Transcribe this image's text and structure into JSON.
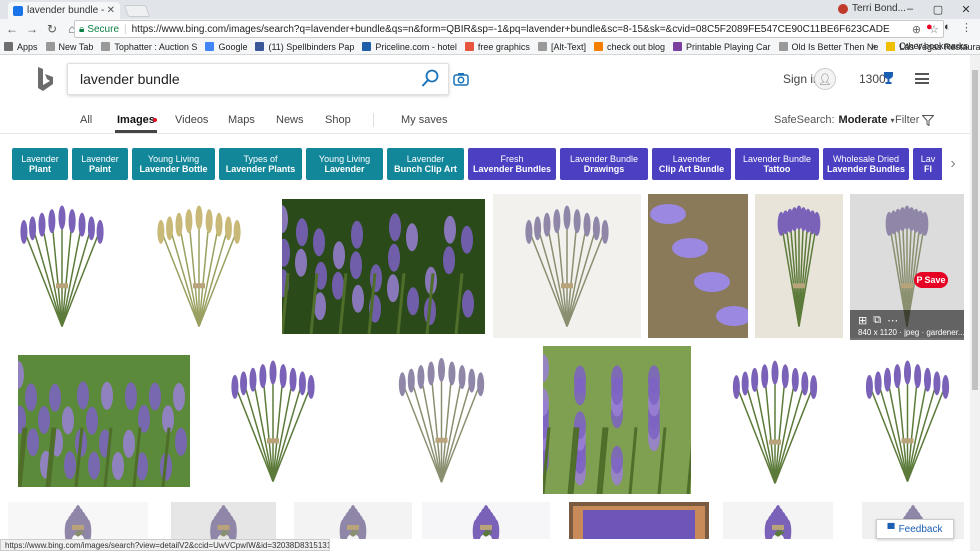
{
  "browser": {
    "tab_title": "lavender bundle - Bing i",
    "profile_name": "Terri Bond...",
    "secure_label": "Secure",
    "url": "https://www.bing.com/images/search?q=lavender+bundle&qs=n&form=QBIR&sp=-1&pq=lavender+bundle&sc=8-15&sk=&cvid=08C5F2089FE547CE90C11BE6F623CADE",
    "bookmarks": [
      {
        "label": "Apps",
        "color": "#6f6f6f"
      },
      {
        "label": "New Tab",
        "color": "#999999"
      },
      {
        "label": "Tophatter : Auction S",
        "color": "#999999"
      },
      {
        "label": "Google",
        "color": "#4285f4"
      },
      {
        "label": "(11) Spellbinders Pap",
        "color": "#3b5998"
      },
      {
        "label": "Priceline.com - hotel",
        "color": "#1f5fa8"
      },
      {
        "label": "free graphics",
        "color": "#e8553e"
      },
      {
        "label": "[Alt-Text]",
        "color": "#999999"
      },
      {
        "label": "check out blog",
        "color": "#f57d00"
      },
      {
        "label": "Printable Playing Car",
        "color": "#7b3fa0"
      },
      {
        "label": "Old Is Better Then Ne",
        "color": "#999999"
      },
      {
        "label": "Las Vegas Restauran",
        "color": "#999999"
      }
    ],
    "more_bookmarks": "»",
    "other_bookmarks": "Other bookmarks",
    "status_url": "https://www.bing.com/images/search?view=detailV2&ccid=UwVCpwIW&id=32038D8315131560..."
  },
  "bing": {
    "search_query": "lavender bundle",
    "sign_in": "Sign in",
    "points": "1300",
    "nav": {
      "all": "All",
      "images": "Images",
      "videos": "Videos",
      "maps": "Maps",
      "news": "News",
      "shop": "Shop",
      "my_saves": "My saves"
    },
    "safesearch_label": "SafeSearch:",
    "safesearch_value": "Moderate",
    "filter_label": "Filter",
    "suggestions": [
      {
        "line1": "Lavender",
        "line2": "Plant",
        "color": "#12879a"
      },
      {
        "line1": "Lavender",
        "line2": "Paint",
        "color": "#12879a"
      },
      {
        "line1": "Young Living",
        "line2": "Lavender Bottle",
        "color": "#12879a"
      },
      {
        "line1": "Types of",
        "line2": "Lavender Plants",
        "color": "#12879a"
      },
      {
        "line1": "Young Living",
        "line2": "Lavender",
        "color": "#12879a"
      },
      {
        "line1": "Lavender",
        "line2": "Bunch Clip Art",
        "color": "#12879a"
      },
      {
        "line1": "Fresh",
        "line2": "Lavender Bundles",
        "color": "#4b3fc2"
      },
      {
        "line1": "Lavender Bundle",
        "line2": "Drawings",
        "color": "#4b3fc2"
      },
      {
        "line1": "Lavender",
        "line2": "Clip Art Bundle",
        "color": "#4b3fc2"
      },
      {
        "line1": "Lavender Bundle",
        "line2": "Tattoo",
        "color": "#4b3fc2"
      },
      {
        "line1": "Wholesale Dried",
        "line2": "Lavender Bundles",
        "color": "#4b3fc2"
      },
      {
        "line1": "Lav",
        "line2": "Fl",
        "color": "#4b3fc2"
      }
    ],
    "pin_save": "Save",
    "image_meta": "840 x 1120 · jpeg · gardener...",
    "feedback": "Feedback"
  }
}
